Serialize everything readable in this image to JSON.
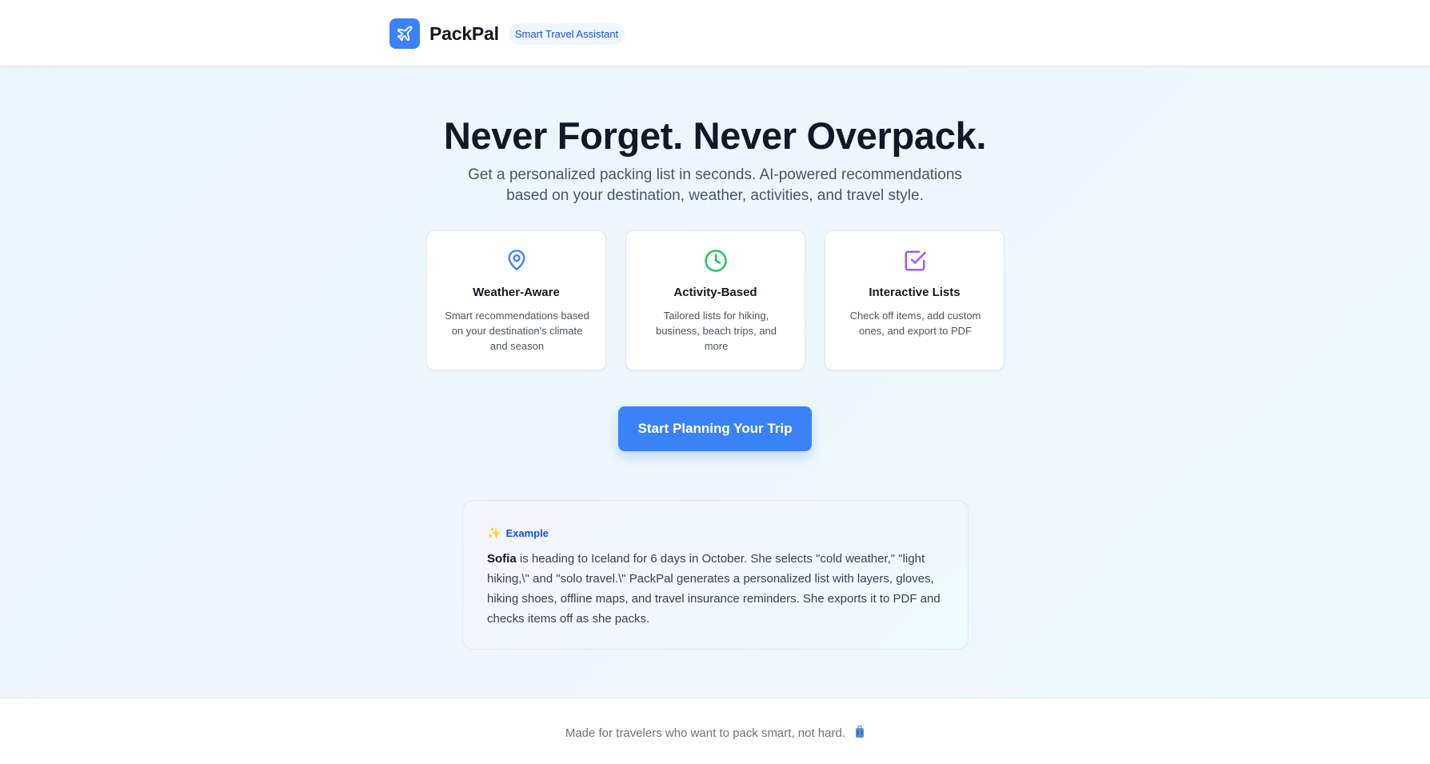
{
  "header": {
    "brand_name": "PackPal",
    "badge": "Smart Travel Assistant",
    "logo_icon": "airplane-icon"
  },
  "hero": {
    "title": "Never Forget. Never Overpack.",
    "subtitle": "Get a personalized packing list in seconds. AI-powered recommendations based on your destination, weather, activities, and travel style."
  },
  "features": [
    {
      "icon": "map-pin-icon",
      "icon_color": "#3b82f6",
      "title": "Weather-Aware",
      "description": "Smart recommendations based on your destination's climate and season"
    },
    {
      "icon": "clock-icon",
      "icon_color": "#22c55e",
      "title": "Activity-Based",
      "description": "Tailored lists for hiking, business, beach trips, and more"
    },
    {
      "icon": "check-square-icon",
      "icon_color": "#a855f7",
      "title": "Interactive Lists",
      "description": "Check off items, add custom ones, and export to PDF"
    }
  ],
  "cta": {
    "label": "Start Planning Your Trip"
  },
  "example": {
    "label": "Example",
    "name": "Sofia",
    "text": " is heading to Iceland for 6 days in October. She selects \"cold weather,\" \"light hiking,\\\" and \"solo travel.\\\" PackPal generates a personalized list with layers, gloves, hiking shoes, offline maps, and travel insurance reminders. She exports it to PDF and checks items off as she packs."
  },
  "footer": {
    "text": "Made for travelers who want to pack smart, not hard.",
    "icon": "luggage-icon"
  },
  "colors": {
    "accent": "#3b82f6",
    "badge_bg": "#eff6ff",
    "badge_text": "#1d4ed8"
  }
}
